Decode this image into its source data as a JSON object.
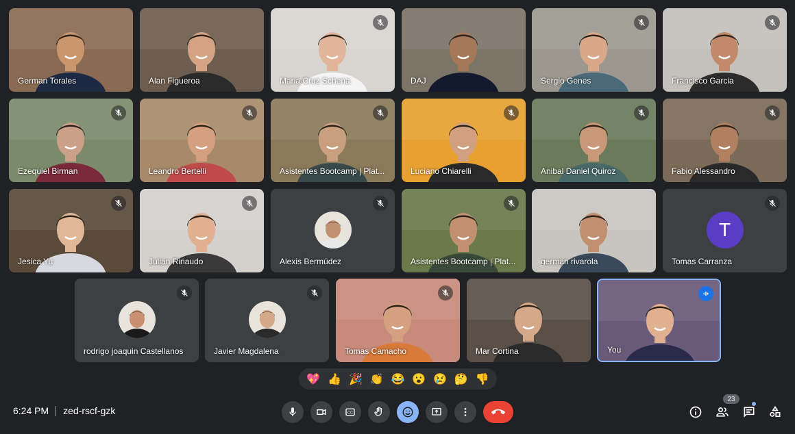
{
  "meeting": {
    "time": "6:24 PM",
    "code": "zed-rscf-gzk"
  },
  "participants": [
    {
      "name": "German Torales",
      "muted": false,
      "kind": "video",
      "bg": "#8a6a52",
      "shirt": "#1e2a44",
      "skin": "#c9966e"
    },
    {
      "name": "Alan Figueroa",
      "muted": false,
      "kind": "video",
      "bg": "#6d5d4e",
      "shirt": "#2a2a2a",
      "skin": "#d4a384"
    },
    {
      "name": "Maria Cruz Schena",
      "muted": true,
      "kind": "video",
      "bg": "#d8d4cf",
      "shirt": "#f4f4f4",
      "skin": "#e2b49a"
    },
    {
      "name": "DAJ",
      "muted": false,
      "kind": "video",
      "bg": "#7c7466",
      "shirt": "#141a2e",
      "skin": "#a6785a"
    },
    {
      "name": "Sergio Genes",
      "muted": true,
      "kind": "video",
      "bg": "#9c9890",
      "shirt": "#4a6a7a",
      "skin": "#d8a888"
    },
    {
      "name": "Francisco Garcia",
      "muted": true,
      "kind": "video",
      "bg": "#c4c0bb",
      "shirt": "#2c2c2c",
      "skin": "#c28a6a"
    },
    {
      "name": "Ezequiel Birman",
      "muted": true,
      "kind": "video",
      "bg": "#7a8a6a",
      "shirt": "#7a2a3a",
      "skin": "#caa088"
    },
    {
      "name": "Leandro Bertelli",
      "muted": true,
      "kind": "video",
      "bg": "#a88a6a",
      "shirt": "#c04a4a",
      "skin": "#d4a080"
    },
    {
      "name": "Asistentes Bootcamp | Plat...",
      "muted": true,
      "kind": "video",
      "bg": "#8a7a5a",
      "shirt": "#3a4a4a",
      "skin": "#c8a080"
    },
    {
      "name": "Luciano Chiarelli",
      "muted": true,
      "kind": "video",
      "bg": "#e8a030",
      "shirt": "#2a2a2a",
      "skin": "#d0a080"
    },
    {
      "name": "Anibal Daniel Quiroz",
      "muted": true,
      "kind": "video",
      "bg": "#6a7a5a",
      "shirt": "#4a6a6a",
      "skin": "#c89878"
    },
    {
      "name": "Fabio Alessandro",
      "muted": true,
      "kind": "video",
      "bg": "#7a6a58",
      "shirt": "#2a2a2a",
      "skin": "#b08060"
    },
    {
      "name": "Jesica Yu",
      "muted": true,
      "kind": "video",
      "bg": "#5a4a3a",
      "shirt": "#d8d8e0",
      "skin": "#e0b898"
    },
    {
      "name": "Julian Rinaudo",
      "muted": true,
      "kind": "video",
      "bg": "#d4d0cc",
      "shirt": "#3a3a3a",
      "skin": "#e0b090"
    },
    {
      "name": "Alexis Bermúdez",
      "muted": true,
      "kind": "avatar",
      "bg": "#3c4043",
      "shirt": "#e8e8e8",
      "skin": "#c09070"
    },
    {
      "name": "Asistentes Bootcamp | Plat...",
      "muted": true,
      "kind": "video",
      "bg": "#6a7a4a",
      "shirt": "#3a4a3a",
      "skin": "#c09070"
    },
    {
      "name": "german rivarola",
      "muted": false,
      "kind": "video",
      "bg": "#c8c4be",
      "shirt": "#3a4a5a",
      "skin": "#c09070"
    },
    {
      "name": "Tomas Carranza",
      "muted": true,
      "kind": "letter",
      "letter": "T",
      "bg": "#3c4043"
    },
    {
      "name": "rodrigo joaquin Castellanos",
      "muted": true,
      "kind": "avatar",
      "bg": "#3c4043",
      "shirt": "#1a1a1a",
      "skin": "#c89070"
    },
    {
      "name": "Javier Magdalena",
      "muted": true,
      "kind": "avatar",
      "bg": "#3c4043",
      "shirt": "#2a2a2a",
      "skin": "#d4a888"
    },
    {
      "name": "Tomas Camacho",
      "muted": true,
      "kind": "video",
      "bg": "#c88a7a",
      "shirt": "#d87a3a",
      "skin": "#d4a080"
    },
    {
      "name": "Mar Cortina",
      "muted": false,
      "kind": "video",
      "bg": "#5a5048",
      "shirt": "#2a2a2a",
      "skin": "#d4a888"
    },
    {
      "name": "You",
      "muted": false,
      "kind": "video",
      "self": true,
      "bg": "#6a5a7a",
      "shirt": "#2a2a4a",
      "skin": "#e0b090"
    }
  ],
  "reactions": [
    "💖",
    "👍",
    "🎉",
    "👏",
    "😂",
    "😮",
    "😢",
    "🤔",
    "👎"
  ],
  "controls": {
    "mic": "mic-icon",
    "camera": "camera-icon",
    "captions": "captions-icon",
    "hand": "raise-hand-icon",
    "emoji": "emoji-icon",
    "present": "present-icon",
    "more": "more-options-icon",
    "end": "end-call-icon"
  },
  "right_controls": {
    "people_count": "23"
  }
}
